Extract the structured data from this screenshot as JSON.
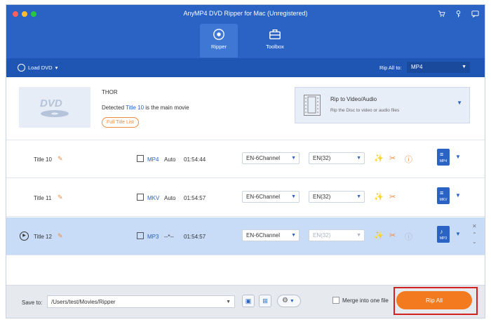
{
  "window": {
    "title": "AnyMP4 DVD Ripper for Mac (Unregistered)",
    "traffic_colors": [
      "#fe5f57",
      "#febc2e",
      "#28c840"
    ]
  },
  "header_icons": [
    "cart-icon",
    "key-icon",
    "chat-icon"
  ],
  "tabs": [
    {
      "label": "Ripper",
      "icon": "disc-icon",
      "active": true
    },
    {
      "label": "Toolbox",
      "icon": "toolbox-icon",
      "active": false
    }
  ],
  "toolbar": {
    "load_dvd_label": "Load DVD",
    "rip_all_to_label": "Rip All to:",
    "rip_all_to_value": "MP4"
  },
  "source": {
    "movie_title": "THOR",
    "detected_prefix": "Detected",
    "detected_title": "Title 10",
    "detected_suffix": "is the main movie",
    "full_title_list_label": "Full Title List",
    "rip_target_title": "Rip to Video/Audio",
    "rip_target_desc": "Rip the Disc to video or audio files"
  },
  "rows": [
    {
      "name": "Title 10",
      "format": "MP4",
      "mode": "Auto",
      "duration": "01:54:44",
      "audio": "EN-6Channel",
      "subtitle": "EN(32)",
      "output_label": "MP4",
      "selected": false
    },
    {
      "name": "Title 11",
      "format": "MKV",
      "mode": "Auto",
      "duration": "01:54:57",
      "audio": "EN-6Channel",
      "subtitle": "EN(32)",
      "output_label": "MKV",
      "selected": false
    },
    {
      "name": "Title 12",
      "format": "MP3",
      "mode": "--*--",
      "duration": "01:54:57",
      "audio": "EN-6Channel",
      "subtitle": "EN(32)",
      "output_label": "MP3",
      "selected": true
    }
  ],
  "footer": {
    "save_to_label": "Save to:",
    "save_path": "/Users/test/Movies/Ripper",
    "merge_label": "Merge into one file",
    "rip_all_label": "Rip All"
  }
}
